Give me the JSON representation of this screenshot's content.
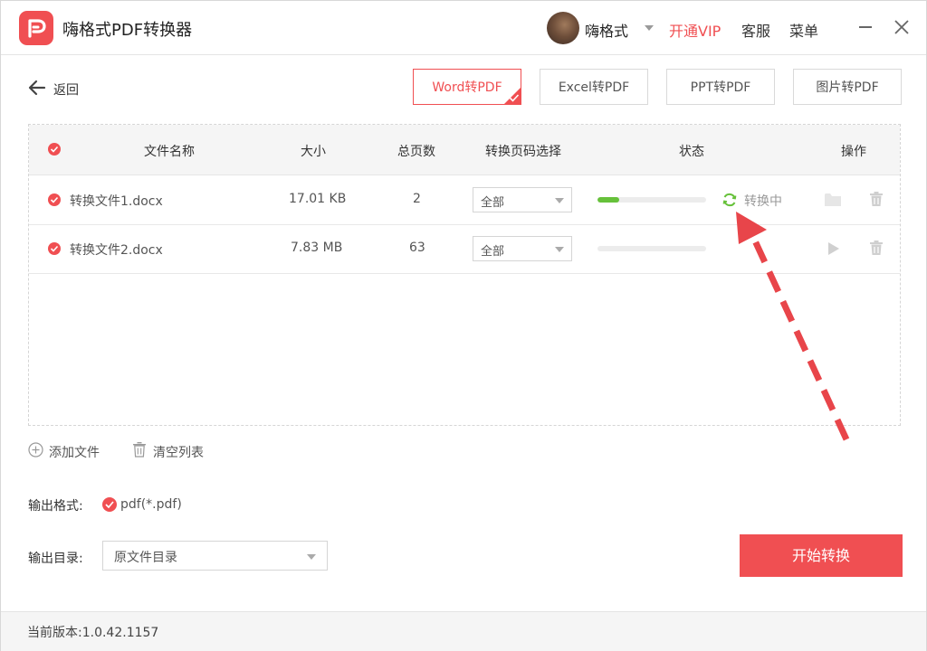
{
  "app": {
    "title": "嗨格式PDF转换器",
    "username": "嗨格式",
    "vip_label": "开通VIP",
    "service_label": "客服",
    "menu_label": "菜单"
  },
  "toolbar": {
    "back_label": "返回",
    "tabs": [
      {
        "label": "Word转PDF",
        "active": true
      },
      {
        "label": "Excel转PDF",
        "active": false
      },
      {
        "label": "PPT转PDF",
        "active": false
      },
      {
        "label": "图片转PDF",
        "active": false
      }
    ]
  },
  "table": {
    "headers": {
      "name": "文件名称",
      "size": "大小",
      "pages": "总页数",
      "range": "转换页码选择",
      "status": "状态",
      "actions": "操作"
    },
    "rows": [
      {
        "name": "转换文件1.docx",
        "size": "17.01 KB",
        "pages": "2",
        "range": "全部",
        "progress": 0.2,
        "status": "转换中"
      },
      {
        "name": "转换文件2.docx",
        "size": "7.83 MB",
        "pages": "63",
        "range": "全部",
        "progress": 0,
        "status": ""
      }
    ]
  },
  "actions": {
    "add_file": "添加文件",
    "clear_list": "清空列表"
  },
  "output": {
    "format_label": "输出格式:",
    "format_value": "pdf(*.pdf)",
    "dir_label": "输出目录:",
    "dir_value": "原文件目录"
  },
  "start_button": "开始转换",
  "footer": {
    "version": "当前版本:1.0.42.1157"
  },
  "colors": {
    "accent": "#f04f52",
    "progress": "#66c13a",
    "annotation_arrow": "#e8454a"
  }
}
